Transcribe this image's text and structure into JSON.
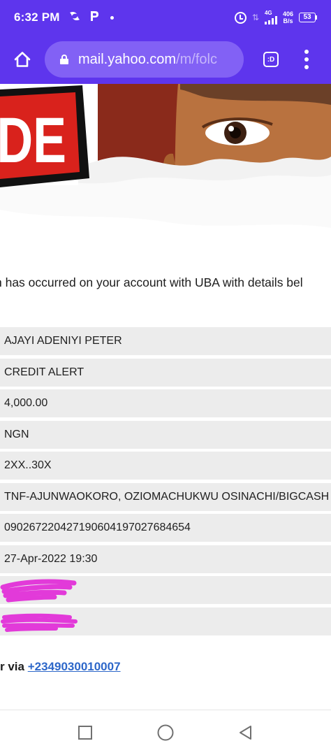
{
  "status_bar": {
    "time": "6:32 PM",
    "left_icons": [
      "vpn-icon",
      "p-app-icon"
    ],
    "network": "4G",
    "speed_value": "406",
    "speed_unit": "B/s",
    "battery": "53"
  },
  "browser": {
    "url_host": "mail.yahoo.com",
    "url_path": "/m/folc",
    "tabs_label": ":D"
  },
  "email": {
    "intro": "n has occurred on your account with UBA with details bel",
    "rows": [
      "AJAYI ADENIYI PETER",
      "CREDIT ALERT",
      "4,000.00",
      "NGN",
      "2XX..30X",
      "TNF-AJUNWAOKORO, OZIOMACHUKWU OSINACHI/BIGCASH",
      "09026722042719060419702768465​4",
      "27-Apr-2022 19:30"
    ],
    "contact_prefix": "r via ",
    "contact_phone": "+2349030010007"
  },
  "colors": {
    "accent": "#5e35ed",
    "url_pill": "#8261f5",
    "row_background": "#ececec",
    "link": "#2d67c9",
    "redaction": "#e23ad9"
  }
}
